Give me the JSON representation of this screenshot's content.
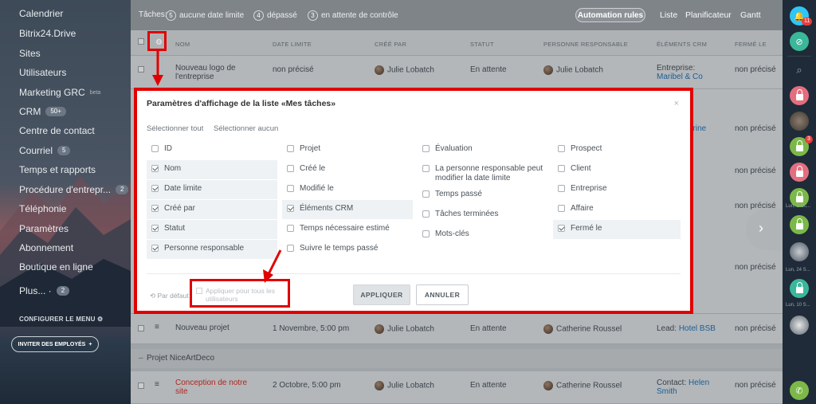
{
  "sidebar": {
    "items": [
      {
        "label": "Calendrier"
      },
      {
        "label": "Bitrix24.Drive"
      },
      {
        "label": "Sites"
      },
      {
        "label": "Utilisateurs"
      },
      {
        "label": "Marketing GRC",
        "sup": "beta"
      },
      {
        "label": "CRM",
        "count": "50+"
      },
      {
        "label": "Centre de contact"
      },
      {
        "label": "Courriel",
        "count": "5"
      },
      {
        "label": "Temps et rapports"
      },
      {
        "label": "Procédure d'entrepr...",
        "count": "2"
      },
      {
        "label": "Téléphonie"
      },
      {
        "label": "Paramètres"
      },
      {
        "label": "Abonnement"
      },
      {
        "label": "Boutique en ligne"
      },
      {
        "label": "Plus... ·",
        "count": "2"
      }
    ],
    "configure_menu": "CONFIGURER LE MENU",
    "invite": "INVITER DES EMPLOYÉS"
  },
  "topbar": {
    "tasks_label": "Tâches:",
    "filters": [
      {
        "count": "5",
        "label": "aucune date limite"
      },
      {
        "count": "4",
        "label": "dépassé"
      },
      {
        "count": "3",
        "label": "en attente de contrôle"
      }
    ],
    "automation": "Automation rules",
    "views": [
      "Liste",
      "Planificateur",
      "Gantt"
    ]
  },
  "table": {
    "headers": [
      "NOM",
      "DATE LIMITE",
      "CRÉÉ PAR",
      "STATUT",
      "PERSONNE RESPONSABLE",
      "ÉLÉMENTS CRM",
      "FERMÉ LE"
    ],
    "row1": {
      "name": "Nouveau logo de l'entreprise",
      "deadline": "non précisé",
      "creator": "Julie Lobatch",
      "status": "En attente",
      "responsible": "Julie Lobatch",
      "crm_prefix": "Entreprise:",
      "crm_link": "Maribel & Co",
      "closed": "non précisé"
    },
    "partial_crm": [
      "erine",
      "non précisé",
      "non précisé",
      "non précisé",
      "non précisé"
    ],
    "row_new": {
      "name": "Nouveau projet",
      "deadline": "1 Novembre, 5:00 pm",
      "creator": "Julie Lobatch",
      "status": "En attente",
      "responsible": "Catherine Roussel",
      "crm_prefix": "Lead:",
      "crm_link": "Hotel BSB",
      "closed": "non précisé"
    },
    "group": "Projet NiceArtDeco",
    "row_last": {
      "name": "Conception de notre site",
      "deadline": "2 Octobre, 5:00 pm",
      "creator": "Julie Lobatch",
      "status": "En attente",
      "responsible": "Catherine Roussel",
      "crm_prefix": "Contact:",
      "crm_link": "Helen Smith",
      "closed": "non précisé"
    }
  },
  "dialog": {
    "title": "Paramètres d'affichage de la liste «Mes tâches»",
    "select_all": "Sélectionner tout",
    "select_none": "Sélectionner aucun",
    "columns": [
      [
        {
          "label": "ID",
          "checked": false
        },
        {
          "label": "Nom",
          "checked": true
        },
        {
          "label": "Date limite",
          "checked": true
        },
        {
          "label": "Créé par",
          "checked": true
        },
        {
          "label": "Statut",
          "checked": true
        },
        {
          "label": "Personne responsable",
          "checked": true
        }
      ],
      [
        {
          "label": "Projet",
          "checked": false
        },
        {
          "label": "Créé le",
          "checked": false
        },
        {
          "label": "Modifié le",
          "checked": false
        },
        {
          "label": "Éléments CRM",
          "checked": true
        },
        {
          "label": "Temps nécessaire estimé",
          "checked": false
        },
        {
          "label": "Suivre le temps passé",
          "checked": false
        }
      ],
      [
        {
          "label": "Évaluation",
          "checked": false
        },
        {
          "label": "La personne responsable peut modifier la date limite",
          "checked": false
        },
        {
          "label": "Temps passé",
          "checked": false
        },
        {
          "label": "Tâches terminées",
          "checked": false
        },
        {
          "label": "Mots-clés",
          "checked": false
        }
      ],
      [
        {
          "label": "Prospect",
          "checked": false
        },
        {
          "label": "Client",
          "checked": false
        },
        {
          "label": "Entreprise",
          "checked": false
        },
        {
          "label": "Affaire",
          "checked": false
        },
        {
          "label": "Fermé le",
          "checked": true
        }
      ]
    ],
    "par_defaut": "Par défaut",
    "apply_all": "Appliquer pour tous les utilisateurs",
    "apply": "APPLIQUER",
    "cancel": "ANNULER"
  },
  "rail": {
    "notif_count": "11",
    "lock_badge": "3",
    "times": [
      "Lun, 1 Oc...",
      "Lun, 24 S...",
      "Lun, 10 S..."
    ]
  }
}
